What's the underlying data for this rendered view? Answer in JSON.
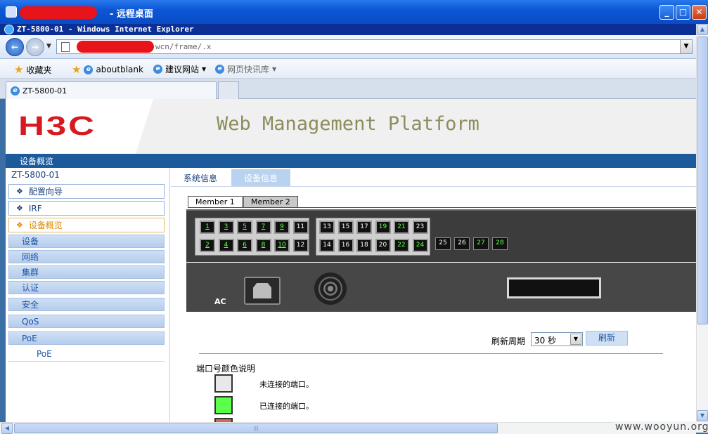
{
  "rdp": {
    "title": "- 远程桌面"
  },
  "ie": {
    "title": "ZT-5800-01 - Windows Internet Explorer",
    "address_visible": "wcn/frame/.x"
  },
  "favorites": {
    "label": "收藏夹",
    "items": [
      "aboutblank",
      "建议网站",
      "网页快讯库"
    ]
  },
  "tab": {
    "title": "ZT-5800-01"
  },
  "brand": {
    "logo": "H3C",
    "platform": "Web Management Platform"
  },
  "page": {
    "nav_title": "设备概览",
    "device": "ZT-5800-01"
  },
  "menu": {
    "nodes": [
      "配置向导",
      "IRF",
      "设备概览"
    ],
    "groups": [
      "设备",
      "网络",
      "集群",
      "认证",
      "安全",
      "QoS",
      "PoE"
    ],
    "sub": "PoE"
  },
  "content": {
    "tabs": [
      "系统信息",
      "设备信息"
    ],
    "members": [
      "Member 1",
      "Member 2"
    ],
    "group1_top": [
      "1",
      "3",
      "5",
      "7",
      "9",
      "11"
    ],
    "group1_bottom": [
      "2",
      "4",
      "6",
      "8",
      "10",
      "12"
    ],
    "group2_top": [
      "13",
      "15",
      "17",
      "19",
      "21",
      "23"
    ],
    "group2_bottom": [
      "14",
      "16",
      "18",
      "20",
      "22",
      "24"
    ],
    "sfp": [
      "25",
      "26",
      "27",
      "28"
    ],
    "ac": "AC",
    "refresh_label": "刷新周期",
    "refresh_value": "30 秒",
    "refresh_btn": "刷新",
    "legend_title": "端口号颜色说明",
    "legend": [
      "未连接的端口。",
      "已连接的端口。"
    ]
  },
  "colors": {
    "port_up": "#5cff4c",
    "port_down": "#e8e8e8",
    "nav": "#1c5a9c",
    "logo": "#d71920"
  },
  "watermark": "www.wooyun.org"
}
